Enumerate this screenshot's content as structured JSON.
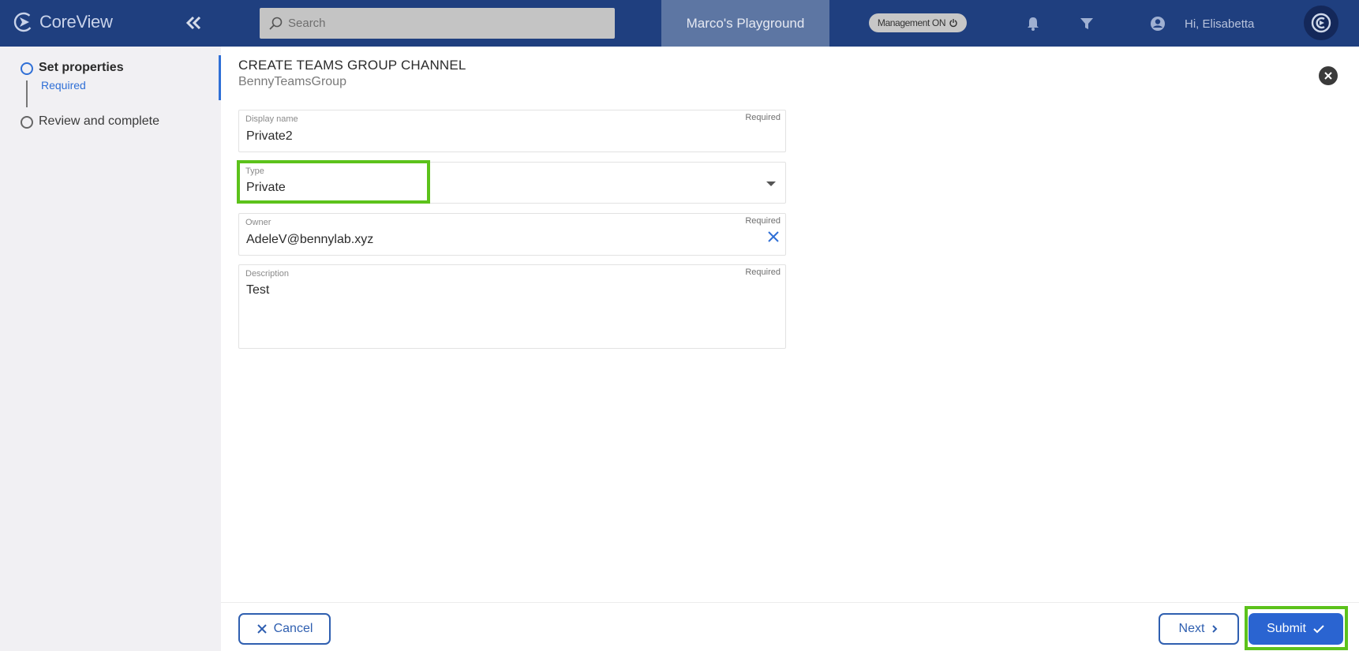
{
  "app": {
    "name": "CoreView"
  },
  "header": {
    "search_placeholder": "Search",
    "tenant": "Marco's Playground",
    "management_badge": "Management ON",
    "greeting": "Hi, Elisabetta"
  },
  "steps": [
    {
      "label": "Set properties",
      "sub": "Required"
    },
    {
      "label": "Review and complete"
    }
  ],
  "form": {
    "title": "CREATE TEAMS GROUP CHANNEL",
    "subtitle": "BennyTeamsGroup",
    "display_name": {
      "label": "Display name",
      "required": "Required",
      "value": "Private2"
    },
    "type": {
      "label": "Type",
      "value": "Private"
    },
    "owner": {
      "label": "Owner",
      "required": "Required",
      "value": "AdeleV@bennylab.xyz"
    },
    "description": {
      "label": "Description",
      "required": "Required",
      "value": "Test"
    }
  },
  "footer": {
    "cancel": "Cancel",
    "next": "Next",
    "submit": "Submit"
  },
  "colors": {
    "topbar": "#1f3f7f",
    "accent": "#2a64d1",
    "highlight": "#5cc21b"
  }
}
